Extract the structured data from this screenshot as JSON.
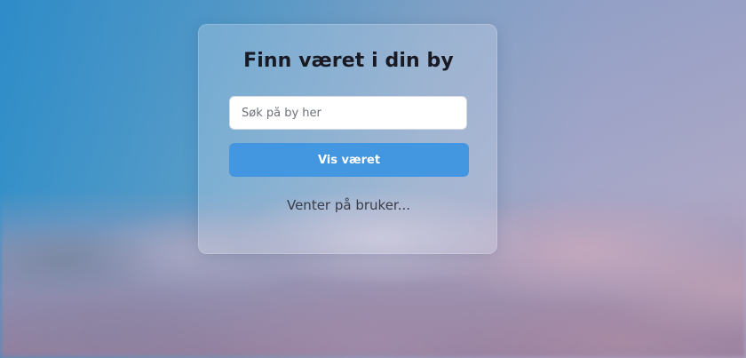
{
  "main": {
    "title": "Finn været i din by",
    "search": {
      "placeholder": "Søk på by her",
      "value": ""
    },
    "submit_label": "Vis været",
    "status": "Venter på bruker..."
  },
  "colors": {
    "button": "#4396e0",
    "title_text": "#1a1a24",
    "status_text": "#3a3d48"
  }
}
